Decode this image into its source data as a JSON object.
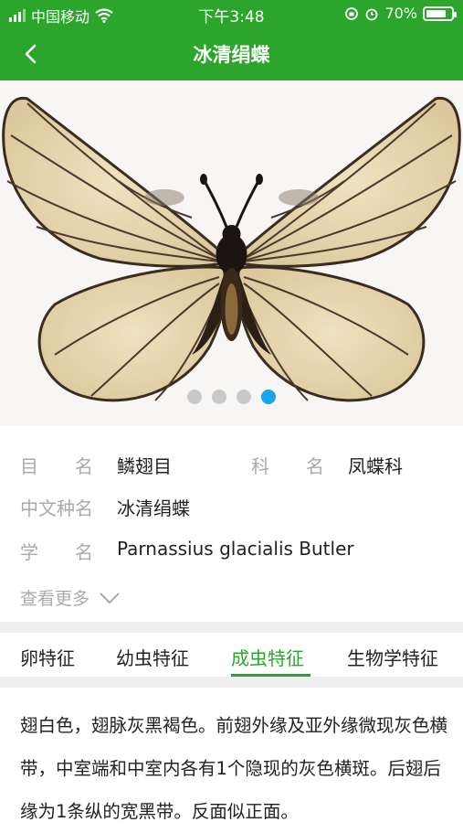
{
  "status_bar": {
    "carrier": "中国移动",
    "time": "下午3:48",
    "battery": "70%"
  },
  "nav": {
    "title": "冰清绢蝶"
  },
  "carousel": {
    "dots": 4,
    "active_index": 3
  },
  "info": {
    "order_label": "目　　名",
    "order_value": "鳞翅目",
    "family_label": "科　　名",
    "family_value": "凤蝶科",
    "cn_name_label": "中文种名",
    "cn_name_value": "冰清绢蝶",
    "sci_label": "学　　名",
    "sci_value": "Parnassius glacialis Butler",
    "more_label": "查看更多"
  },
  "tabs": [
    {
      "label": "卵特征"
    },
    {
      "label": "幼虫特征"
    },
    {
      "label": "成虫特征"
    },
    {
      "label": "生物学特征"
    }
  ],
  "active_tab": 2,
  "description": "翅白色，翅脉灰黑褐色。前翅外缘及亚外缘微现灰色横带，中室端和中室内各有1个隐现的灰色横斑。后翅后缘为1条纵的宽黑带。反面似正面。",
  "colors": {
    "brand_green": "#2ca52c",
    "dot_active": "#1aa3e8"
  }
}
